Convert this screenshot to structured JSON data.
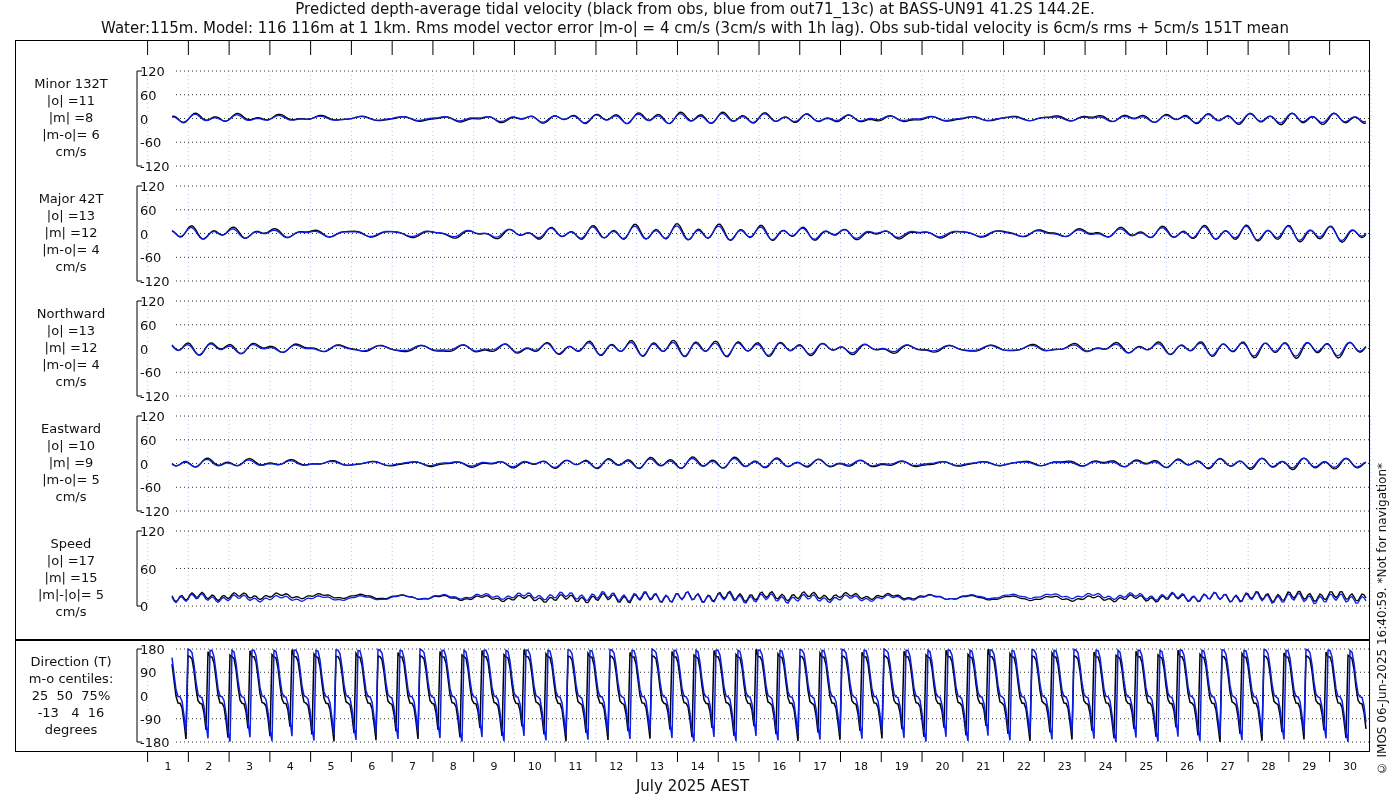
{
  "title": {
    "line1": "Predicted depth-average tidal velocity (black from obs, blue from out71_13c) at BASS-UN91 41.2S 144.2E.",
    "line2": "Water:115m. Model: 116 116m at 1 1km. Rms model vector error |m-o| = 4 cm/s (3cm/s with 1h lag). Obs sub-tidal velocity is 6cm/s rms + 5cm/s 151T mean"
  },
  "panels": [
    {
      "kind": "velocity",
      "label_lines": [
        "Minor 132T",
        "|o| =11",
        "|m| =8",
        "|m-o|= 6",
        "cm/s"
      ],
      "yticks": [
        "120",
        "60",
        "0",
        "-60",
        "-120"
      ]
    },
    {
      "kind": "velocity",
      "label_lines": [
        "Major 42T",
        "|o| =13",
        "|m| =12",
        "|m-o|= 4",
        "cm/s"
      ],
      "yticks": [
        "120",
        "60",
        "0",
        "-60",
        "-120"
      ]
    },
    {
      "kind": "velocity",
      "label_lines": [
        "Northward",
        "|o| =13",
        "|m| =12",
        "|m-o|= 4",
        "cm/s"
      ],
      "yticks": [
        "120",
        "60",
        "0",
        "-60",
        "-120"
      ]
    },
    {
      "kind": "velocity",
      "label_lines": [
        "Eastward",
        "|o| =10",
        "|m| =9",
        "|m-o|= 5",
        "cm/s"
      ],
      "yticks": [
        "120",
        "60",
        "0",
        "-60",
        "-120"
      ]
    },
    {
      "kind": "speed",
      "label_lines": [
        "Speed",
        "|o| =17",
        "|m| =15",
        "|m|-|o|= 5",
        "cm/s"
      ],
      "yticks": [
        "120",
        "60",
        "0"
      ]
    },
    {
      "kind": "direction",
      "label_lines": [
        "Direction (T)",
        "m-o centiles:",
        "25  50  75%",
        "-13   4  16",
        "degrees"
      ],
      "yticks": [
        "180",
        "90",
        "0",
        "-90",
        "-180"
      ]
    }
  ],
  "x_axis": {
    "ticks": [
      "1",
      "2",
      "3",
      "4",
      "5",
      "6",
      "7",
      "8",
      "9",
      "10",
      "11",
      "12",
      "13",
      "14",
      "15",
      "16",
      "17",
      "18",
      "19",
      "20",
      "21",
      "22",
      "23",
      "24",
      "25",
      "26",
      "27",
      "28",
      "29",
      "30"
    ],
    "label": "July 2025 AEST"
  },
  "credit": "© IMOS 06-Jun-2025 16:40:59.  *Not for navigation*"
}
